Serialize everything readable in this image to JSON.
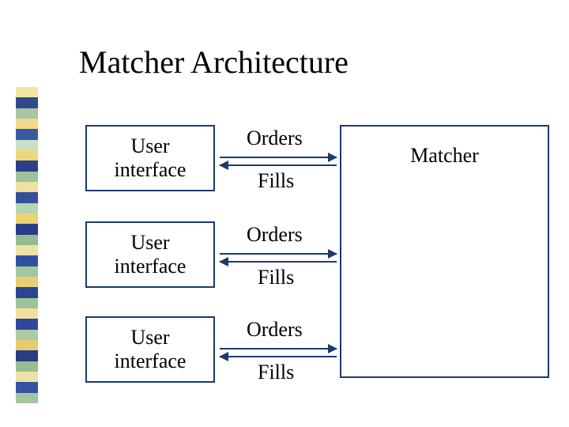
{
  "title": "Matcher Architecture",
  "left_boxes": [
    {
      "label": "User\ninterface"
    },
    {
      "label": "User\ninterface"
    },
    {
      "label": "User\ninterface"
    }
  ],
  "right_box": {
    "label": "Matcher"
  },
  "flows": [
    {
      "to_right": "Orders",
      "to_left": "Fills"
    },
    {
      "to_right": "Orders",
      "to_left": "Fills"
    },
    {
      "to_right": "Orders",
      "to_left": "Fills"
    }
  ],
  "sidebar_colors": [
    "#f2e6a2",
    "#2e4a8a",
    "#a7c6a5",
    "#f4d98c",
    "#3a5aa0",
    "#c9dfc7",
    "#efd67a",
    "#2d3f88",
    "#9fc29b",
    "#f0df9e",
    "#34509a",
    "#b6d3b2",
    "#ecd270",
    "#2a3c85",
    "#94ba91",
    "#efe2a8",
    "#3150a0",
    "#a3c6a0",
    "#e8cf75",
    "#2c4590",
    "#9ec39a",
    "#f1e0a0",
    "#30489a",
    "#aacba6",
    "#e6cc6e",
    "#2a3c85",
    "#97bd93",
    "#efe2a8",
    "#3552a4",
    "#a3c6a0"
  ]
}
